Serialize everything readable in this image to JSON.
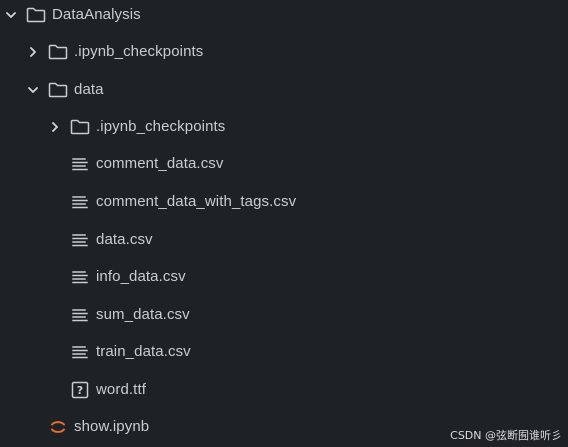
{
  "file_tree": {
    "items": [
      {
        "label": "DataAnalysis",
        "type": "folder",
        "expanded": true,
        "depth": 0,
        "icon": "folder-icon",
        "chevron": "chevron-down-icon"
      },
      {
        "label": ".ipynb_checkpoints",
        "type": "folder",
        "expanded": false,
        "depth": 1,
        "icon": "folder-icon",
        "chevron": "chevron-right-icon"
      },
      {
        "label": "data",
        "type": "folder",
        "expanded": true,
        "depth": 1,
        "icon": "folder-icon",
        "chevron": "chevron-down-icon"
      },
      {
        "label": ".ipynb_checkpoints",
        "type": "folder",
        "expanded": false,
        "depth": 2,
        "icon": "folder-icon",
        "chevron": "chevron-right-icon"
      },
      {
        "label": "comment_data.csv",
        "type": "file",
        "depth": 2,
        "icon": "text-file-icon"
      },
      {
        "label": "comment_data_with_tags.csv",
        "type": "file",
        "depth": 2,
        "icon": "text-file-icon"
      },
      {
        "label": "data.csv",
        "type": "file",
        "depth": 2,
        "icon": "text-file-icon"
      },
      {
        "label": "info_data.csv",
        "type": "file",
        "depth": 2,
        "icon": "text-file-icon"
      },
      {
        "label": "sum_data.csv",
        "type": "file",
        "depth": 2,
        "icon": "text-file-icon"
      },
      {
        "label": "train_data.csv",
        "type": "file",
        "depth": 2,
        "icon": "text-file-icon"
      },
      {
        "label": "word.ttf",
        "type": "file",
        "depth": 2,
        "icon": "unknown-file-icon"
      },
      {
        "label": "show.ipynb",
        "type": "notebook",
        "depth": 1,
        "icon": "jupyter-notebook-icon"
      }
    ]
  },
  "watermark": "CSDN @弦断囿谁听彡",
  "colors": {
    "background": "#1e2126",
    "text": "#c9ccd1",
    "icon": "#c9ccd1",
    "jupyter_accent": "#e46e2e"
  }
}
